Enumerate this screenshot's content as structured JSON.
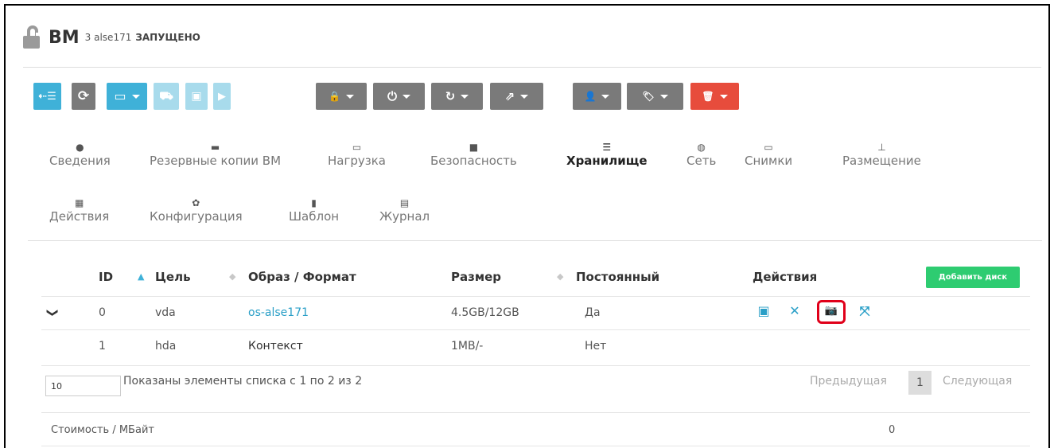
{
  "header": {
    "title": "ВМ",
    "id_name": "3 alse171",
    "state": "ЗАПУЩЕНО",
    "icon": "lock-open-icon"
  },
  "toolbar": {
    "buttons": [
      {
        "icon": "back-list-icon",
        "glyph": "⇠☰",
        "color": "blue"
      },
      {
        "icon": "refresh-icon",
        "glyph": "⟳",
        "color": "gray"
      },
      {
        "icon": "monitor-icon",
        "glyph": "▭",
        "color": "blue",
        "dropdown": true
      },
      {
        "icon": "cart-icon",
        "glyph": "⛟",
        "color": "pale"
      },
      {
        "icon": "save-icon",
        "glyph": "▣",
        "color": "pale"
      },
      {
        "icon": "play-icon",
        "glyph": "▶",
        "color": "pale"
      },
      {
        "icon": "lock-icon",
        "glyph": "🔒",
        "color": "gray",
        "dropdown": true
      },
      {
        "icon": "power-icon",
        "glyph": "⏻",
        "color": "gray",
        "dropdown": true
      },
      {
        "icon": "restart-icon",
        "glyph": "↻",
        "color": "gray",
        "dropdown": true
      },
      {
        "icon": "share-icon",
        "glyph": "⇗",
        "color": "gray",
        "dropdown": true
      },
      {
        "icon": "user-icon",
        "glyph": "👤",
        "color": "gray",
        "dropdown": true
      },
      {
        "icon": "tags-icon",
        "glyph": "🏷",
        "color": "gray",
        "dropdown": true
      },
      {
        "icon": "trash-icon",
        "glyph": "🗑",
        "color": "red",
        "dropdown": true
      }
    ]
  },
  "tabs": [
    {
      "label": "Сведения",
      "icon": "info-icon",
      "active": false
    },
    {
      "label": "Резервные копии ВМ",
      "icon": "archive-icon",
      "active": false
    },
    {
      "label": "Нагрузка",
      "icon": "laptop-icon",
      "active": false
    },
    {
      "label": "Безопасность",
      "icon": "lock-icon",
      "active": false
    },
    {
      "label": "Хранилище",
      "icon": "server-icon",
      "active": true
    },
    {
      "label": "Сеть",
      "icon": "globe-icon",
      "active": false
    },
    {
      "label": "Снимки",
      "icon": "laptop-icon",
      "active": false
    },
    {
      "label": "Размещение",
      "icon": "sitemap-icon",
      "active": false
    },
    {
      "label": "Действия",
      "icon": "calendar-icon",
      "active": false
    },
    {
      "label": "Конфигурация",
      "icon": "gear-icon",
      "active": false
    },
    {
      "label": "Шаблон",
      "icon": "file-icon",
      "active": false
    },
    {
      "label": "Журнал",
      "icon": "file-text-icon",
      "active": false
    }
  ],
  "table": {
    "headers": {
      "id": "ID",
      "target": "Цель",
      "image": "Образ / Формат",
      "size": "Размер",
      "persistent": "Постоянный",
      "actions": "Действия"
    },
    "add_disk_label": "Добавить диск",
    "rows": [
      {
        "expand": "❯",
        "id": "0",
        "target": "vda",
        "image": "os-alse171",
        "size": "4.5GB/12GB",
        "persistent": "Да"
      },
      {
        "expand": "",
        "id": "1",
        "target": "hda",
        "image": "Контекст",
        "size": "1MB/-",
        "persistent": "Нет"
      }
    ],
    "row_actions": [
      {
        "icon": "save-icon",
        "glyph": "▣"
      },
      {
        "icon": "close-icon",
        "glyph": "✕"
      },
      {
        "icon": "camera-icon",
        "glyph": "📷",
        "highlighted": true
      },
      {
        "icon": "expand-icon",
        "glyph": "⤧"
      }
    ]
  },
  "pagination": {
    "page_length": "10",
    "info": "Показаны элементы списка с 1 по 2 из 2",
    "prev": "Предыдущая",
    "current": "1",
    "next": "Следующая"
  },
  "cost": {
    "label": "Стоимость / МБайт",
    "value": "0"
  },
  "colors": {
    "blue": "#3fb1d8",
    "pale": "#a8dbec",
    "gray": "#7a7a7a",
    "red": "#e74c3c",
    "green": "#2ecc71",
    "highlight": "#e0001a"
  }
}
